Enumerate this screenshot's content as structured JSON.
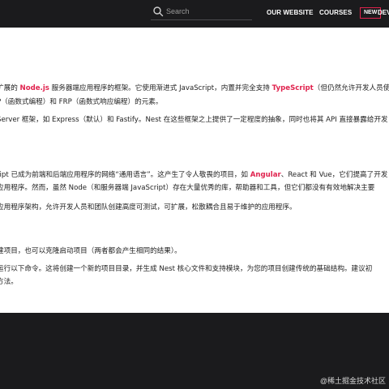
{
  "header": {
    "search_placeholder": "Search",
    "nav": [
      "OUR WEBSITE",
      "COURSES"
    ],
    "badge": "NEW",
    "dev_link": "DEV"
  },
  "content": {
    "l1": {
      "a": "扩展的 ",
      "b": "Node.js",
      "c": " 服务器端应用程序的框架。它使用渐进式 JavaScript，内置并完全支持 ",
      "d": "TypeScript",
      "e": "（但仍然允许开发人员使"
    },
    "l2": "P（函数式编程）和 FRP（函数式响应编程）的元素。",
    "l3": "Server 框架，如 Express（默认）和 Fastify。Nest 在这些框架之上提供了一定程度的抽象，同时也将其 API 直接暴露给开发",
    "l4": {
      "a": "ript 已成为前端和后端应用程序的网络“通用语言”。这产生了令人敬畏的项目，如 ",
      "b": "Angular",
      "c": "、React 和 Vue，它们提高了开发"
    },
    "l5": "应用程序。然而，虽然 Node（和服务器端 JavaScript）存在大量优秀的库，帮助器和工具，但它们都没有有效地解决主要",
    "l6": "应用程序架构，允许开发人员和团队创建高度可测试，可扩展，松散耦合且易于维护的应用程序。",
    "l7": "建项目，也可以克隆启动项目（两者都会产生相同的结果）。",
    "l8": "运行以下命令。这将创建一个新的项目目录，并生成 Nest 核心文件和支持模块，为您的项目创建传统的基础结构。建议初",
    "l9": "方法。"
  },
  "footer": {
    "watermark": "@稀土掘金技术社区"
  },
  "colors": {
    "accent": "#e0234e",
    "bar": "#1b1b1d"
  },
  "icons": {
    "search": "search-icon"
  }
}
